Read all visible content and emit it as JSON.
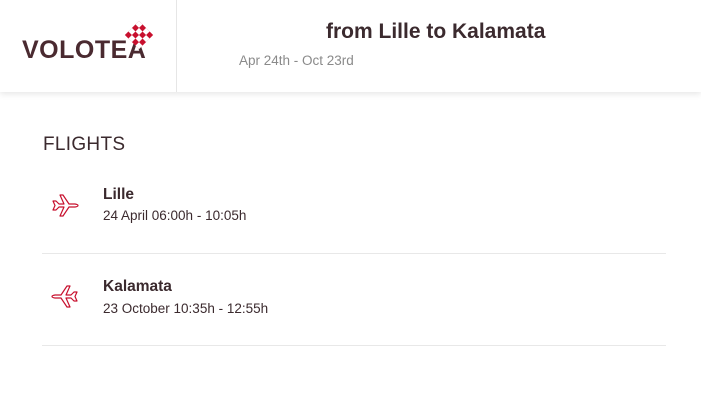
{
  "header": {
    "logo_text": "VOLOTEA",
    "route_title": "from Lille to Kalamata",
    "date_range": "Apr 24th - Oct 23rd"
  },
  "flights_section": {
    "title": "FLIGHTS",
    "items": [
      {
        "city": "Lille",
        "time": "24 April 06:00h - 10:05h",
        "icon": "plane-takeoff-icon"
      },
      {
        "city": "Kalamata",
        "time": "23 October 10:35h - 12:55h",
        "icon": "plane-landing-icon"
      }
    ]
  },
  "colors": {
    "brand_dark": "#4a2a30",
    "brand_accent": "#c8102e",
    "text_muted": "#8a8a8a",
    "divider": "#e8e8e8"
  }
}
